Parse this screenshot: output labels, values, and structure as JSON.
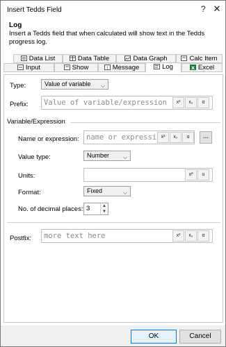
{
  "window": {
    "title": "Insert Tedds Field",
    "help": "?",
    "close": "✕"
  },
  "header": {
    "title": "Log",
    "description": "Insert a Tedds field that when calculated will show text in the Tedds progress log."
  },
  "tabs": {
    "top_row": [
      {
        "label": "Data List",
        "icon": "data-list-icon"
      },
      {
        "label": "Data Table",
        "icon": "data-table-icon"
      },
      {
        "label": "Data Graph",
        "icon": "data-graph-icon"
      },
      {
        "label": "Calc Item",
        "icon": "calc-item-icon"
      }
    ],
    "bottom_row": [
      {
        "label": "Input",
        "icon": "input-icon"
      },
      {
        "label": "Show",
        "icon": "show-icon"
      },
      {
        "label": "Message",
        "icon": "message-icon"
      },
      {
        "label": "Log",
        "icon": "log-icon",
        "active": true
      },
      {
        "label": "Excel",
        "icon": "excel-icon",
        "color": "#1d7a3a"
      }
    ]
  },
  "form": {
    "type_label": "Type:",
    "type_value": "Value of variable",
    "prefix_label": "Prefix:",
    "prefix_placeholder": "Value of variable/expression",
    "group_label": "Variable/Expression",
    "name_label": "Name or expression:",
    "name_placeholder": "name or expression",
    "browse_label": "...",
    "value_type_label": "Value type:",
    "value_type_value": "Number",
    "units_label": "Units:",
    "units_value": "",
    "format_label": "Format:",
    "format_value": "Fixed",
    "decimals_label": "No. of decimal places:",
    "decimals_value": "3",
    "postfix_label": "Postfix:",
    "postfix_placeholder": "more text here",
    "fmt_sup": "x²",
    "fmt_sub": "x₂",
    "fmt_alpha": "α",
    "fmt_u": "u"
  },
  "buttons": {
    "ok": "OK",
    "cancel": "Cancel"
  },
  "colors": {
    "accent": "#0078d7",
    "excel": "#1d7a3a"
  }
}
